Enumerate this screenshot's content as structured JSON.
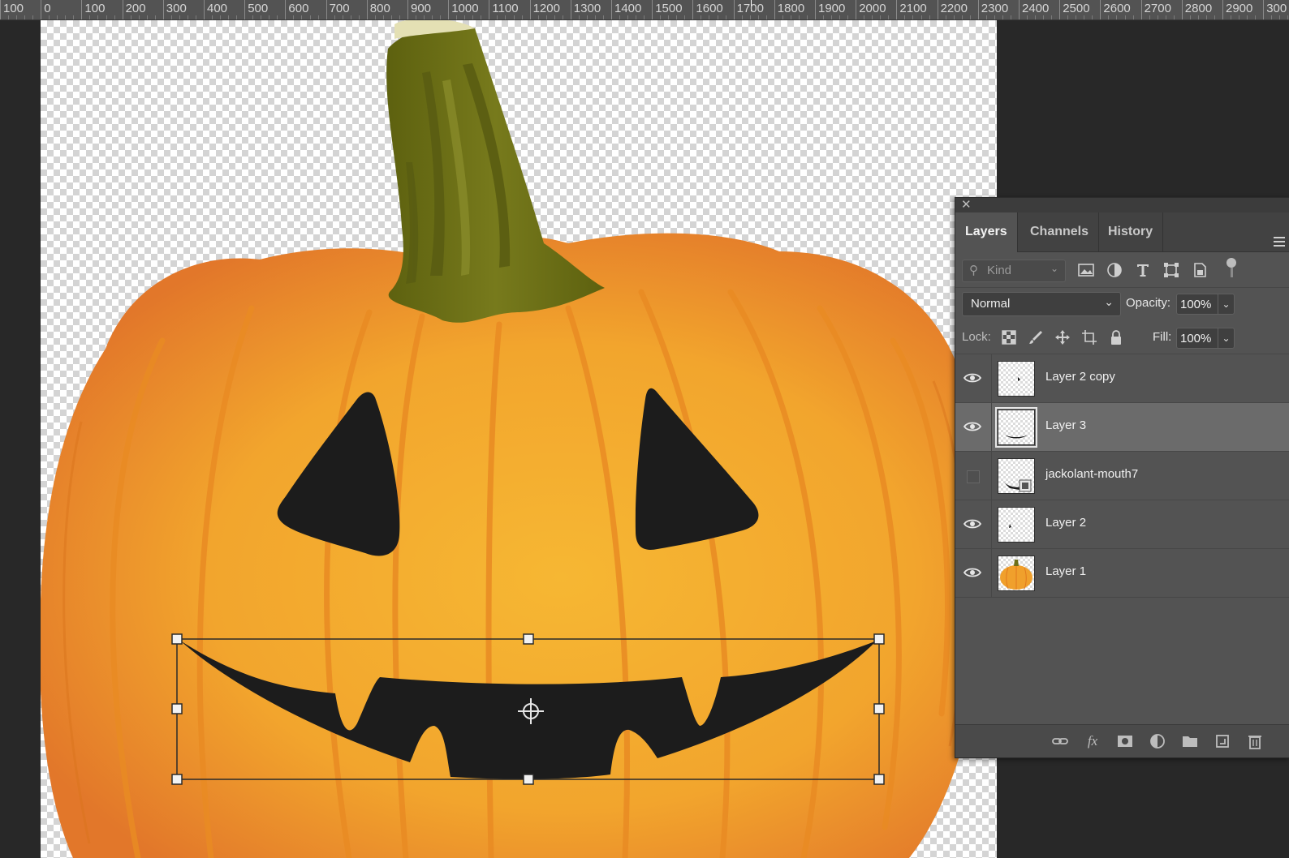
{
  "ruler": {
    "labels": [
      "100",
      "0",
      "100",
      "200",
      "300",
      "400",
      "500",
      "600",
      "700",
      "800",
      "900",
      "1000",
      "1100",
      "1200",
      "1300",
      "1400",
      "1500",
      "1600",
      "1700",
      "1800",
      "1900",
      "2000",
      "2100",
      "2200",
      "2300",
      "2400",
      "2500",
      "2600",
      "2700",
      "2800",
      "2900",
      "300"
    ]
  },
  "canvas": {
    "description_colors": {
      "pumpkin_light": "#f4b232",
      "pumpkin_dark": "#e0781e",
      "stem": "#6d6f18",
      "face": "#1c1c1c"
    }
  },
  "layers_panel": {
    "tabs": [
      {
        "label": "Layers",
        "active": true
      },
      {
        "label": "Channels",
        "active": false
      },
      {
        "label": "History",
        "active": false
      }
    ],
    "filter": {
      "kind_label": "Kind"
    },
    "blend_mode": "Normal",
    "opacity_label": "Opacity:",
    "opacity_value": "100%",
    "lock_label": "Lock:",
    "fill_label": "Fill:",
    "fill_value": "100%",
    "layers": [
      {
        "name": "Layer 2 copy",
        "visible": true,
        "selected": false
      },
      {
        "name": "Layer 3",
        "visible": true,
        "selected": true
      },
      {
        "name": "jackolant-mouth7",
        "visible": false,
        "selected": false
      },
      {
        "name": "Layer 2",
        "visible": true,
        "selected": false
      },
      {
        "name": "Layer 1",
        "visible": true,
        "selected": false
      }
    ],
    "footer_icons": [
      "link-icon",
      "fx-icon",
      "mask-icon",
      "adjustment-icon",
      "folder-icon",
      "new-layer-icon",
      "trash-icon"
    ]
  }
}
